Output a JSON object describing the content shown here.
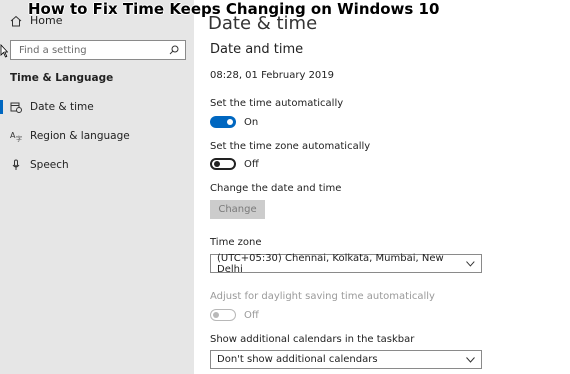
{
  "overlay": {
    "title": "How to Fix Time Keeps Changing on Windows 10"
  },
  "sidebar": {
    "home_label": "Home",
    "search_placeholder": "Find a setting",
    "section_title": "Time & Language",
    "items": [
      {
        "label": "Date & time",
        "icon": "calendar-clock-icon",
        "active": true
      },
      {
        "label": "Region & language",
        "icon": "language-icon",
        "active": false
      },
      {
        "label": "Speech",
        "icon": "microphone-icon",
        "active": false
      }
    ]
  },
  "main": {
    "page_title": "Date & time",
    "subtitle": "Date and time",
    "current_datetime": "08:28, 01 February 2019",
    "set_time_auto": {
      "label": "Set the time automatically",
      "state": "On",
      "on": true
    },
    "set_timezone_auto": {
      "label": "Set the time zone automatically",
      "state": "Off",
      "on": false
    },
    "change_date_time": {
      "label": "Change the date and time",
      "button": "Change"
    },
    "time_zone": {
      "label": "Time zone",
      "value": "(UTC+05:30) Chennai, Kolkata, Mumbai, New Delhi"
    },
    "daylight_saving": {
      "label": "Adjust for daylight saving time automatically",
      "state": "Off",
      "enabled": false
    },
    "additional_calendars": {
      "label": "Show additional calendars in the taskbar",
      "value": "Don't show additional calendars"
    }
  },
  "colors": {
    "accent": "#0067c0",
    "sidebar_bg": "#e6e6e6",
    "disabled_text": "#9a9a9a"
  }
}
